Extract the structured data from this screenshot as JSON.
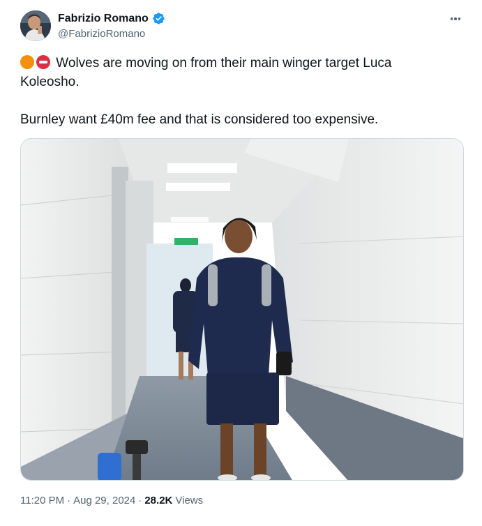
{
  "author": {
    "display_name": "Fabrizio Romano",
    "handle": "@FabrizioRomano",
    "verified": true,
    "verified_color": "#1d9bf0"
  },
  "tweet": {
    "line1": "Wolves are moving on from their main winger target Luca",
    "line2": "Koleosho.",
    "line3": "Burnley want £40m fee and that is considered too expensive.",
    "emojis": [
      "orange-circle",
      "no-entry"
    ]
  },
  "media": {
    "description_icon": "photo"
  },
  "meta": {
    "time": "11:20 PM",
    "separator": "·",
    "date": "Aug 29, 2024",
    "views_count": "28.2K",
    "views_label": "Views"
  }
}
